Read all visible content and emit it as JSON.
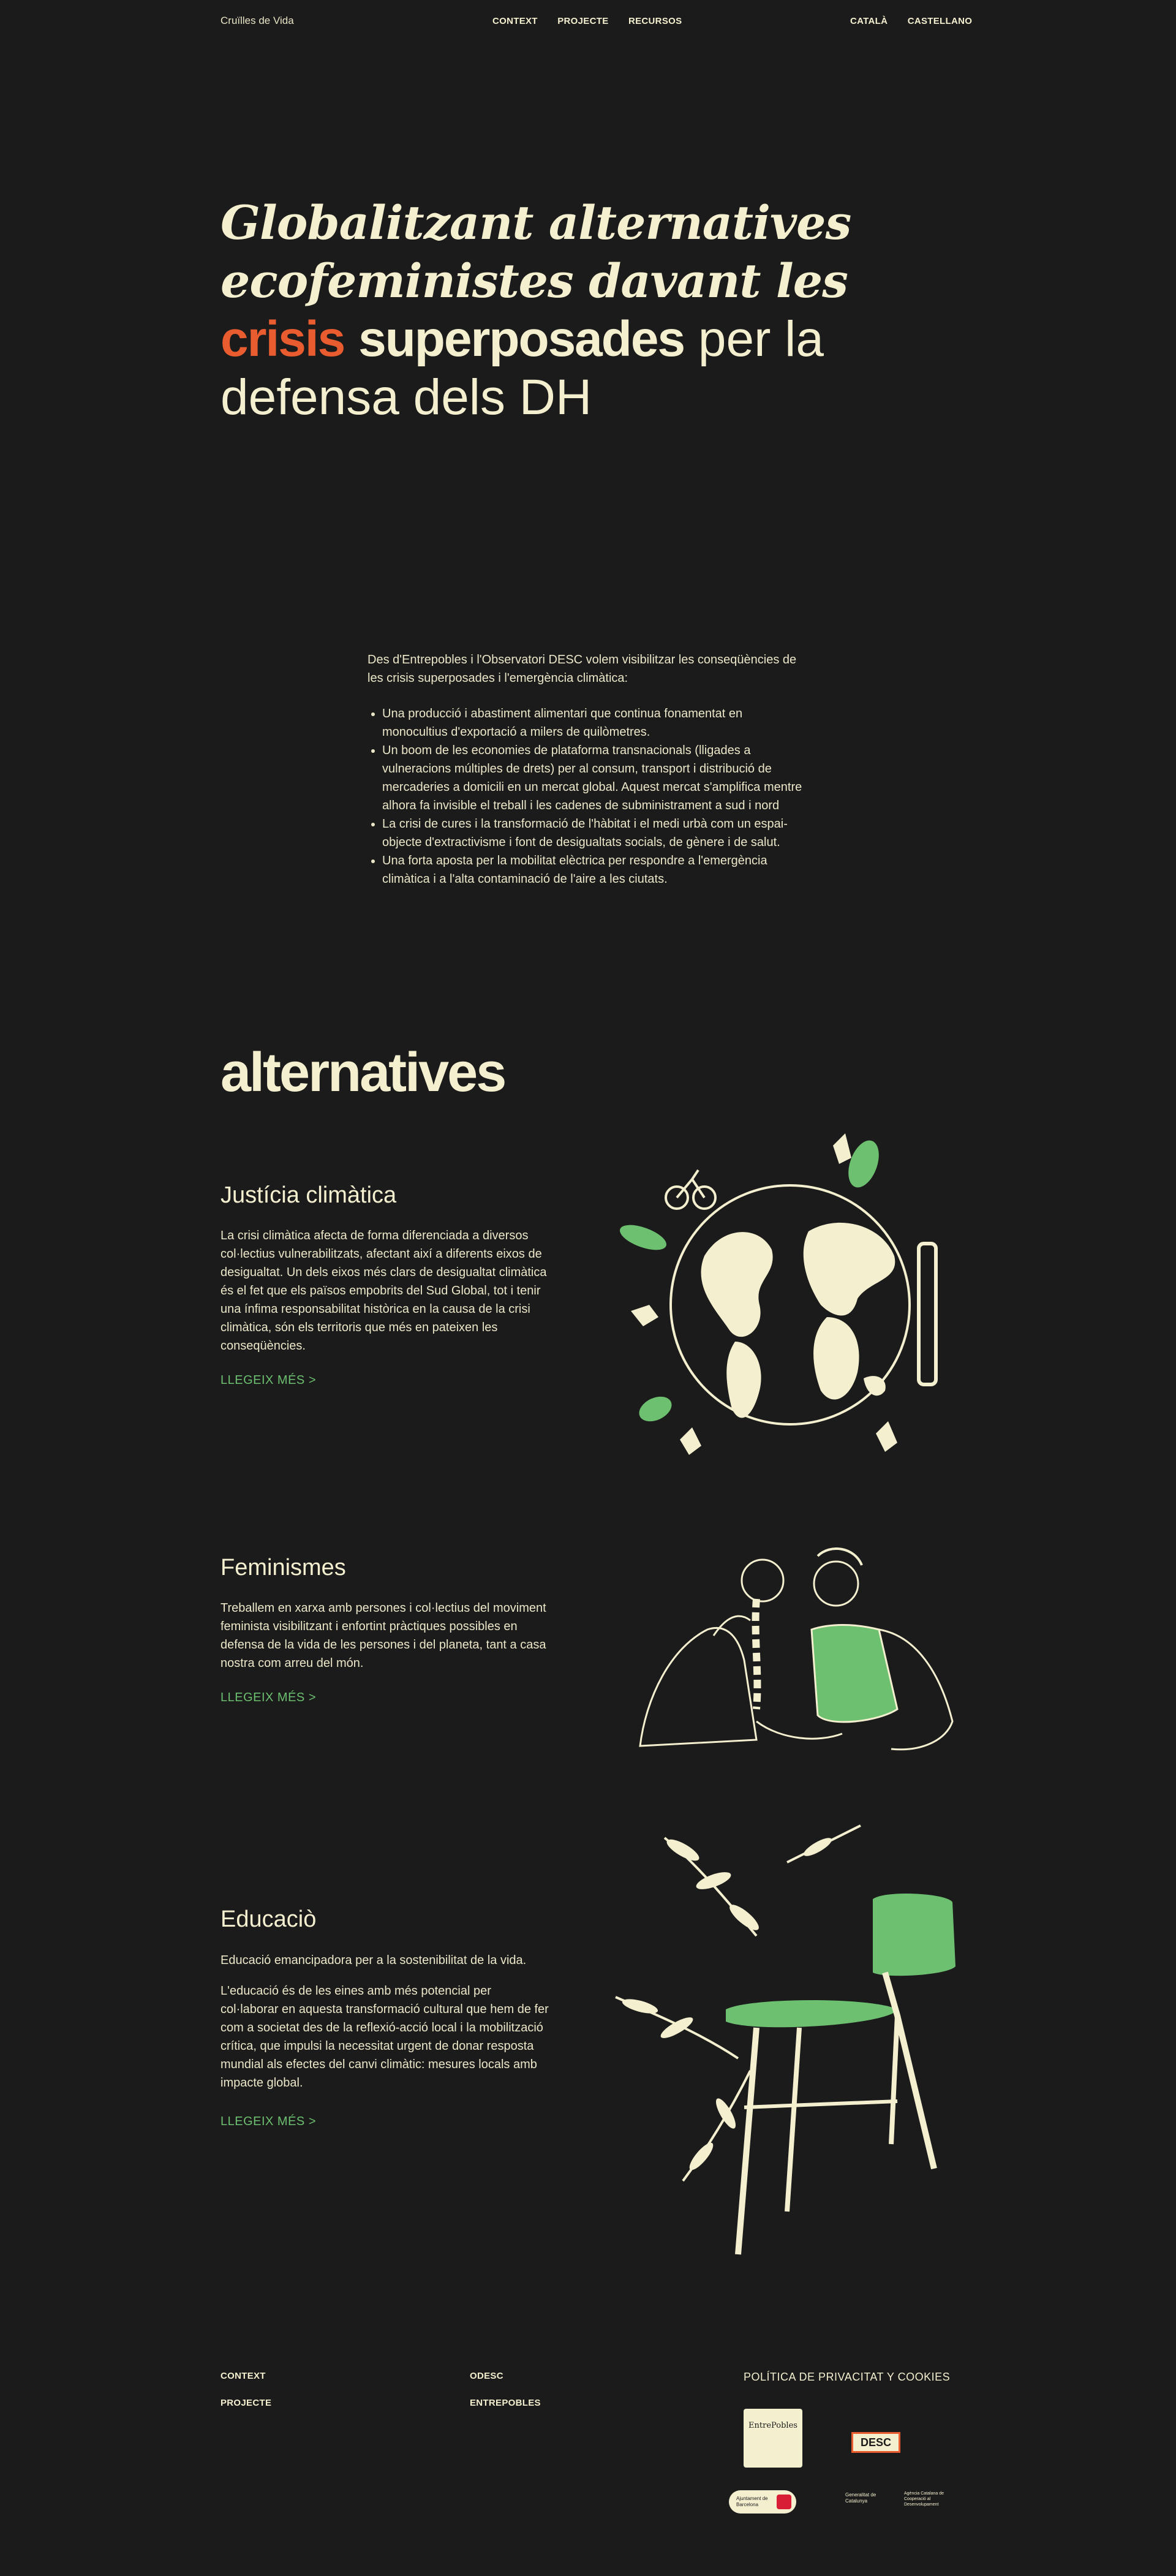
{
  "header": {
    "brand": "Cruïlles de Vida",
    "nav": [
      "CONTEXT",
      "PROJECTE",
      "RECURSOS"
    ],
    "languages": [
      "CATALÀ",
      "CASTELLANO"
    ]
  },
  "hero": {
    "line1": "Globalitzant alternatives",
    "line2": "ecofeministes davant les",
    "crisis": "crisis",
    "superposades": "superposades",
    "per_la": "per la",
    "line4": "defensa dels DH"
  },
  "intro": {
    "lead": "Des d'Entrepobles i l'Observatori DESC volem visibilitzar les conseqüències de les crisis superposades i l'emergència climàtica:",
    "bullets": [
      "Una producció i abastiment alimentari que continua fonamentat en monocultius d'exportació a milers de quilòmetres.",
      "Un boom de les economies de plataforma transnacionals (lligades a vulneracions múltiples de drets) per al consum, transport i distribució de mercaderies a domicili en un mercat global. Aquest mercat s'amplifica mentre alhora fa invisible el treball i les cadenes de subministrament a sud i nord",
      "La crisi de cures i la transformació de l'hàbitat i el medi urbà com un espai-objecte d'extractivisme i font de desigualtats socials, de gènere i de salut.",
      "Una forta aposta per la mobilitat elèctrica per respondre a l'emergència climàtica i a l'alta contaminació de l'aire a les ciutats."
    ]
  },
  "alternatives": {
    "title": "alternatives",
    "sections": [
      {
        "title": "Justícia climàtica",
        "paragraphs": [
          "La crisi climàtica afecta de forma diferenciada a diversos col·lectius vulnerabilitzats, afectant així a diferents eixos de desigualtat. Un dels eixos més clars de desigualtat climàtica és el fet que els països empobrits del Sud Global, tot i tenir una ínfima responsabilitat històrica en la causa de la crisi climàtica, són els territoris que més en pateixen les conseqüències."
        ],
        "link": "LLEGEIX MÉS >"
      },
      {
        "title": "Feminismes",
        "paragraphs": [
          "Treballem en xarxa amb persones i col·lectius del moviment feminista visibilitzant i enfortint pràctiques possibles en defensa de la vida de les persones i del planeta, tant a casa nostra com arreu del món."
        ],
        "link": "LLEGEIX MÉS >"
      },
      {
        "title": "Educaciò",
        "paragraphs": [
          "Educació emancipadora per a la sostenibilitat de la vida.",
          "L'educació és de les eines amb més potencial per col·laborar en aquesta transformació cultural que hem de fer com a societat des de la reflexió-acció local i la mobilització crítica, que impulsi la necessitat urgent de donar resposta mundial als efectes del canvi climàtic: mesures locals amb impacte global."
        ],
        "link": "LLEGEIX MÉS >"
      }
    ]
  },
  "footer": {
    "col1": [
      "CONTEXT",
      "PROJECTE"
    ],
    "col2": [
      "ODESC",
      "ENTREPOBLES"
    ],
    "policy": "POLÍTICA DE PRIVACITAT Y COOKIES",
    "logos": [
      "EntrePobles",
      "DESC",
      "Ajuntament de Barcelona",
      "Generalitat de Catalunya",
      "Agència Catalana de Cooperació al Desenvolupament"
    ]
  },
  "colors": {
    "background": "#1b1b1b",
    "cream": "#f4efcf",
    "accent_orange": "#e85c2f",
    "accent_green": "#6cc070"
  }
}
